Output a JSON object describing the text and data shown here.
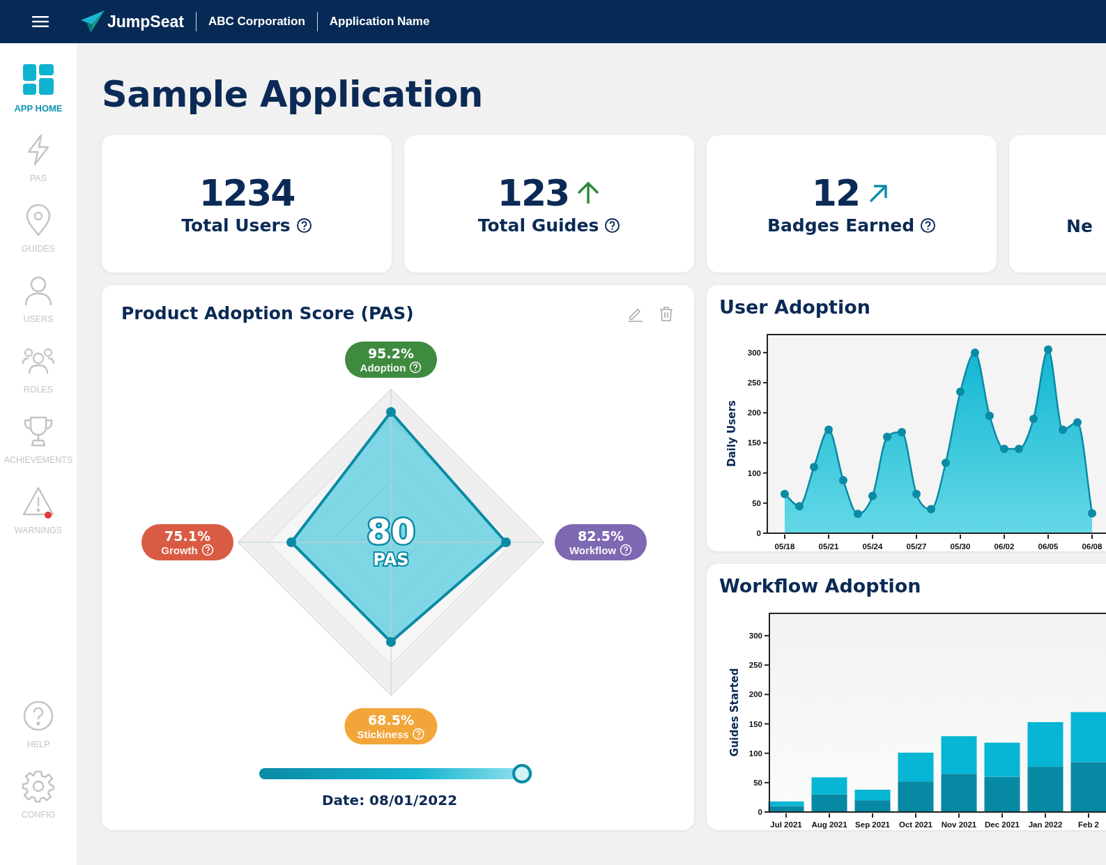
{
  "header": {
    "brand": "JumpSeat",
    "organization": "ABC Corporation",
    "application": "Application Name"
  },
  "sidebar": {
    "items": [
      {
        "label": "APP HOME",
        "selected": true,
        "alert": false
      },
      {
        "label": "PAS",
        "selected": false,
        "alert": false
      },
      {
        "label": "GUIDES",
        "selected": false,
        "alert": false
      },
      {
        "label": "USERS",
        "selected": false,
        "alert": false
      },
      {
        "label": "ROLES",
        "selected": false,
        "alert": false
      },
      {
        "label": "ACHIEVEMENTS",
        "selected": false,
        "alert": false
      },
      {
        "label": "WARNINGS",
        "selected": false,
        "alert": true
      }
    ],
    "footer_items": [
      {
        "label": "HELP",
        "selected": false
      },
      {
        "label": "CONFIG",
        "selected": false
      }
    ]
  },
  "page_title": "Sample Application",
  "stats": [
    {
      "value": "1234",
      "label": "Total Users",
      "kind": "plain",
      "help": true
    },
    {
      "value": "123",
      "label": "Total Guides",
      "kind": "rising",
      "help": true
    },
    {
      "value": "12",
      "label": "Badges Earned",
      "kind": "trending",
      "help": true
    },
    {
      "label": "Ne",
      "kind": "plain",
      "help": false
    }
  ],
  "pas_card": {
    "title": "Product Adoption Score (PAS)",
    "score": "80",
    "score_label": "PAS",
    "axes": [
      {
        "value": "95.2%",
        "label": "Adoption",
        "color": "#3e8a3f",
        "level": 0.85
      },
      {
        "value": "82.5%",
        "label": "Workflow",
        "color": "#7d68b1",
        "level": 0.75
      },
      {
        "value": "68.5%",
        "label": "Stickiness",
        "color": "#f2a63a",
        "level": 0.65
      },
      {
        "value": "75.1%",
        "label": "Growth",
        "color": "#d95b43",
        "level": 0.65
      }
    ],
    "slider": {
      "level": 0.96
    },
    "date_label": "Date: 08/01/2022"
  },
  "user_adoption": {
    "title": "User Adoption",
    "chart_data": {
      "type": "area",
      "ylabel": "Daily Users",
      "categories": [
        "05/18",
        null,
        null,
        "05/21",
        null,
        null,
        "05/24",
        null,
        null,
        "05/27",
        null,
        null,
        "05/30",
        null,
        null,
        "06/02",
        null,
        null,
        "06/05",
        null,
        null,
        "06/08"
      ],
      "series": [
        {
          "color": "#0a8aa5",
          "values": [
            65,
            45,
            110,
            172,
            88,
            32,
            62,
            160,
            168,
            65,
            40,
            117,
            235,
            300,
            195,
            140,
            140,
            190,
            305,
            172,
            184,
            33
          ]
        }
      ],
      "ylim": [
        0,
        330
      ],
      "yticks": [
        0,
        50,
        100,
        150,
        200,
        250,
        300
      ]
    }
  },
  "workflow_adoption": {
    "title": "Workflow Adoption",
    "chart_data": {
      "type": "bar",
      "ylabel": "Guides Started",
      "stacked": true,
      "categories": [
        "Jul 2021",
        "Aug 2021",
        "Sep 2021",
        "Oct 2021",
        "Nov 2021",
        "Dec 2021",
        "Jan 2022",
        "Feb 2"
      ],
      "series": [
        {
          "color": "#0788a3",
          "values": [
            10,
            30,
            20,
            52,
            65,
            60,
            77,
            85
          ]
        },
        {
          "color": "#06b6d4",
          "values": [
            8,
            29,
            18,
            49,
            64,
            58,
            76,
            85
          ]
        }
      ],
      "ylim": [
        0,
        338
      ],
      "yticks": [
        0,
        50,
        100,
        150,
        200,
        250,
        300
      ]
    }
  }
}
